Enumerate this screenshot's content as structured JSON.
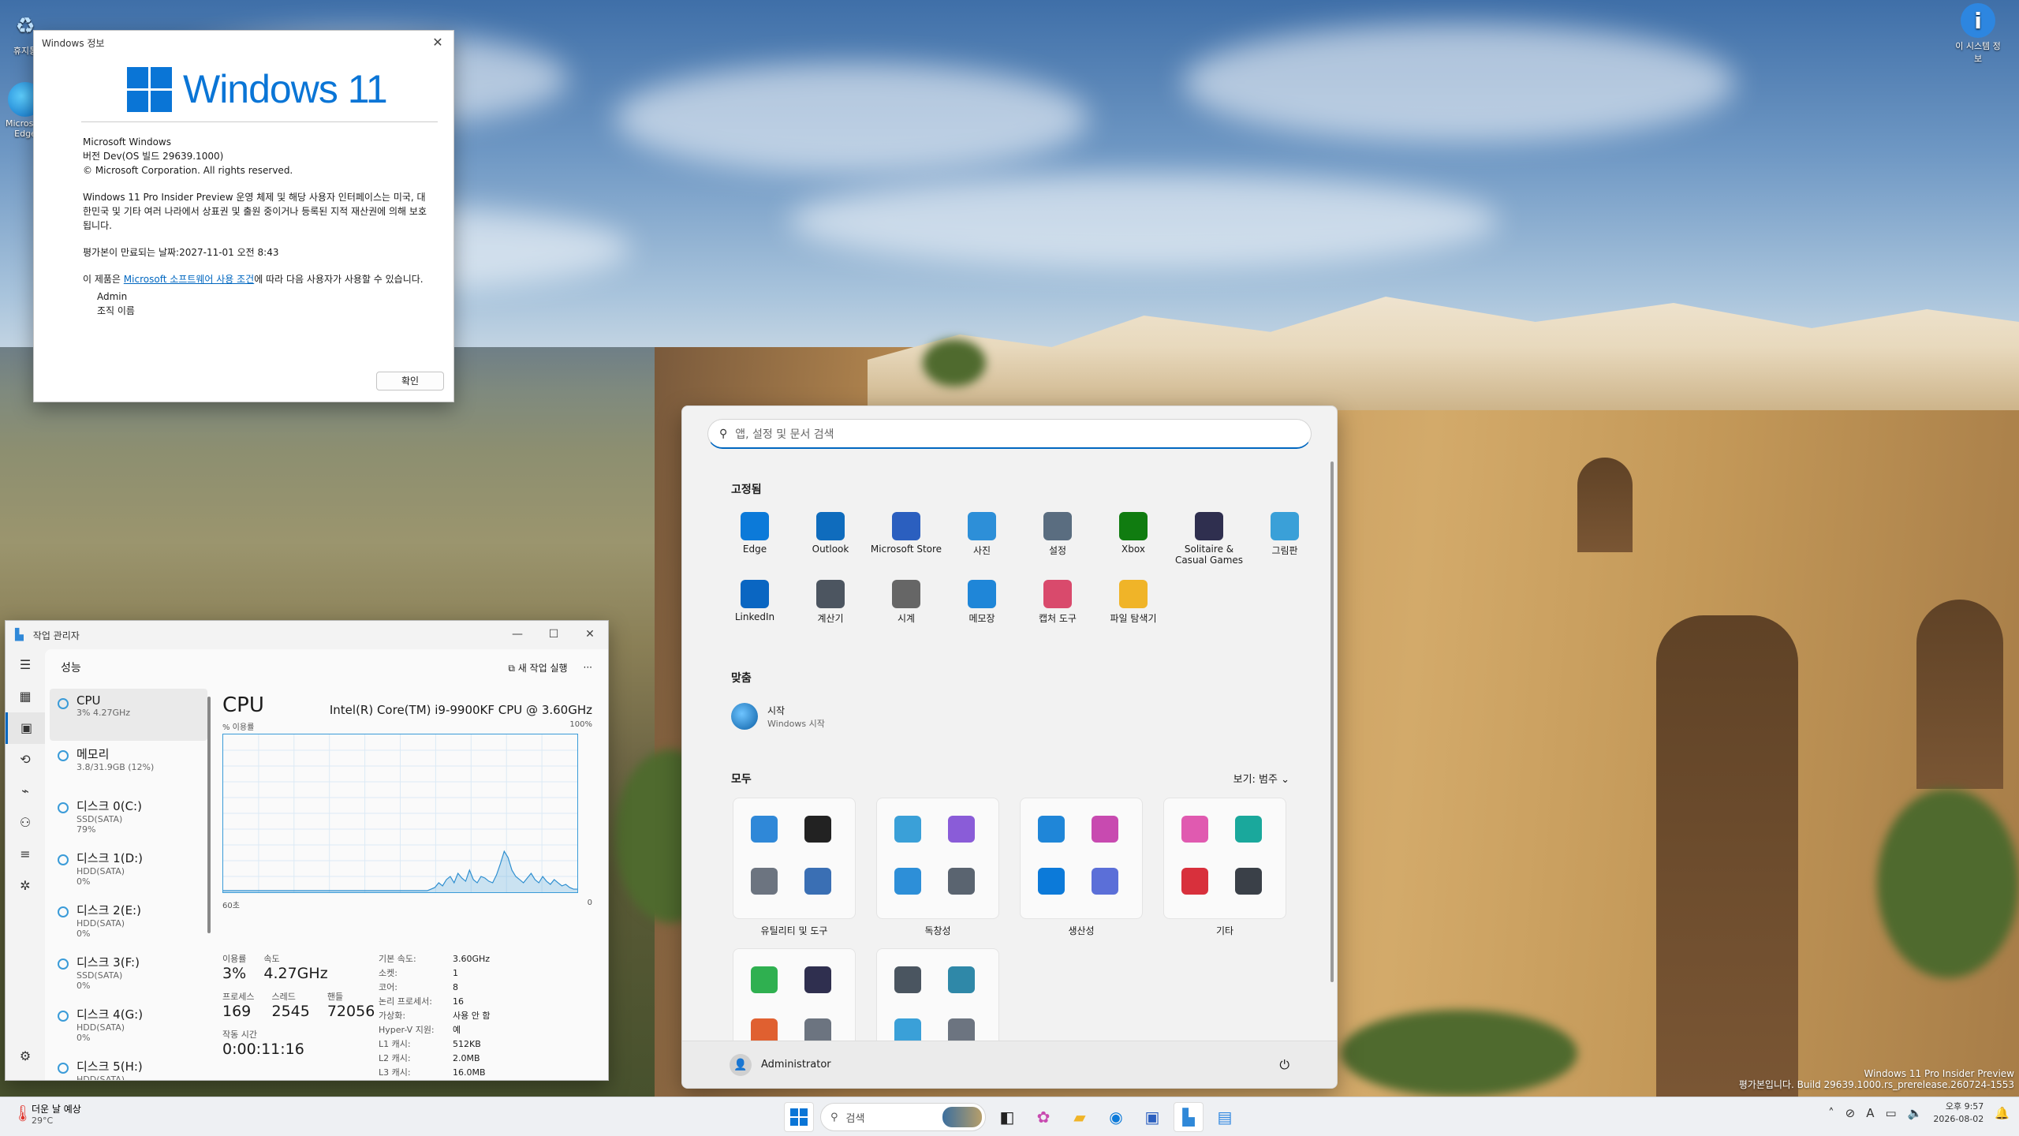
{
  "desktop": {
    "icons_left": [
      {
        "label": "휴지통",
        "icon": "recycle-bin-icon"
      },
      {
        "label": "Microsoft Edge",
        "icon": "edge-icon"
      }
    ],
    "icon_right": {
      "label": "이 시스템 정보",
      "icon": "info-icon"
    }
  },
  "about_dialog": {
    "title": "Windows 정보",
    "logo_text": "Windows 11",
    "product": "Microsoft Windows",
    "version": "버전 Dev(OS 빌드 29639.1000)",
    "copyright": "© Microsoft Corporation. All rights reserved.",
    "description": "Windows 11 Pro Insider Preview 운영 체제 및 해당 사용자 인터페이스는 미국, 대한민국 및 기타 여러 나라에서 상표권 및 출원 중이거나 등록된 지적 재산권에 의해 보호됩니다.",
    "expiry": "평가본이 만료되는 날짜:2027-11-01 오전 8:43",
    "license_prefix": "이 제품은 ",
    "license_link": "Microsoft 소프트웨어 사용 조건",
    "license_suffix": "에 따라 다음 사용자가 사용할 수 있습니다.",
    "user": "Admin",
    "org": "조직 이름",
    "ok_label": "확인"
  },
  "task_manager": {
    "title": "작업 관리자",
    "section": "성능",
    "run_new_task": "새 작업 실행",
    "more": "···",
    "items": [
      {
        "name": "CPU",
        "sub1": "3% 4.27GHz",
        "sub2": ""
      },
      {
        "name": "메모리",
        "sub1": "3.8/31.9GB (12%)",
        "sub2": ""
      },
      {
        "name": "디스크 0(C:)",
        "sub1": "SSD(SATA)",
        "sub2": "79%"
      },
      {
        "name": "디스크 1(D:)",
        "sub1": "HDD(SATA)",
        "sub2": "0%"
      },
      {
        "name": "디스크 2(E:)",
        "sub1": "HDD(SATA)",
        "sub2": "0%"
      },
      {
        "name": "디스크 3(F:)",
        "sub1": "SSD(SATA)",
        "sub2": "0%"
      },
      {
        "name": "디스크 4(G:)",
        "sub1": "HDD(SATA)",
        "sub2": "0%"
      },
      {
        "name": "디스크 5(H:)",
        "sub1": "HDD(SATA)",
        "sub2": ""
      }
    ],
    "cpu": {
      "title": "CPU",
      "model": "Intel(R) Core(TM) i9-9900KF CPU @ 3.60GHz",
      "usage_label": "% 이용률",
      "max_label": "100%",
      "time_label": "60초",
      "min_label": "0",
      "history": [
        1,
        1,
        1,
        1,
        1,
        1,
        1,
        1,
        1,
        1,
        1,
        1,
        1,
        1,
        1,
        1,
        1,
        1,
        1,
        1,
        1,
        1,
        1,
        1,
        1,
        1,
        1,
        1,
        1,
        1,
        1,
        1,
        1,
        1,
        1,
        1,
        1,
        1,
        1,
        1,
        1,
        1,
        1,
        1,
        1,
        1,
        1,
        1,
        1,
        1,
        1,
        1,
        1,
        1,
        2,
        3,
        6,
        4,
        8,
        10,
        6,
        12,
        9,
        7,
        14,
        8,
        6,
        10,
        9,
        7,
        6,
        11,
        18,
        26,
        22,
        14,
        10,
        8,
        6,
        9,
        12,
        8,
        6,
        10,
        7,
        5,
        8,
        6,
        4,
        5,
        3,
        2,
        2
      ],
      "utilization_label": "이용률",
      "utilization": "3%",
      "speed_label": "속도",
      "speed": "4.27GHz",
      "processes_label": "프로세스",
      "processes": "169",
      "threads_label": "스레드",
      "threads": "2545",
      "handles_label": "핸들",
      "handles": "72056",
      "uptime_label": "작동 시간",
      "uptime": "0:00:11:16",
      "specs": [
        {
          "k": "기본 속도:",
          "v": "3.60GHz"
        },
        {
          "k": "소켓:",
          "v": "1"
        },
        {
          "k": "코어:",
          "v": "8"
        },
        {
          "k": "논리 프로세서:",
          "v": "16"
        },
        {
          "k": "가상화:",
          "v": "사용 안 함"
        },
        {
          "k": "Hyper-V 지원:",
          "v": "예"
        },
        {
          "k": "L1 캐시:",
          "v": "512KB"
        },
        {
          "k": "L2 캐시:",
          "v": "2.0MB"
        },
        {
          "k": "L3 캐시:",
          "v": "16.0MB"
        }
      ]
    }
  },
  "start_menu": {
    "search_placeholder": "앱, 설정 및 문서 검색",
    "pinned_title": "고정됨",
    "pinned": [
      {
        "label": "Edge",
        "icon": "edge-icon",
        "color": "#0c7ad9"
      },
      {
        "label": "Outlook",
        "icon": "outlook-icon",
        "color": "#0f6cbd"
      },
      {
        "label": "Microsoft Store",
        "icon": "store-icon",
        "color": "#2b5fbf"
      },
      {
        "label": "사진",
        "icon": "photos-icon",
        "color": "#2d8fd8"
      },
      {
        "label": "설정",
        "icon": "gear-icon",
        "color": "#5a6d80"
      },
      {
        "label": "Xbox",
        "icon": "xbox-icon",
        "color": "#107c10"
      },
      {
        "label": "Solitaire & Casual Games",
        "icon": "solitaire-icon",
        "color": "#2f2f4f"
      },
      {
        "label": "그림판",
        "icon": "paint-icon",
        "color": "#3aa0d8"
      },
      {
        "label": "LinkedIn",
        "icon": "linkedin-icon",
        "color": "#0a66c2"
      },
      {
        "label": "계산기",
        "icon": "calculator-icon",
        "color": "#4c5560"
      },
      {
        "label": "시계",
        "icon": "clock-icon",
        "color": "#666666"
      },
      {
        "label": "메모장",
        "icon": "notepad-icon",
        "color": "#1f86d8"
      },
      {
        "label": "캡처 도구",
        "icon": "snipping-tool-icon",
        "color": "#d94a6c"
      },
      {
        "label": "파일 탐색기",
        "icon": "folder-icon",
        "color": "#f0b428"
      }
    ],
    "recommended_title": "맞춤",
    "recommended": {
      "title": "시작",
      "subtitle": "Windows 시작"
    },
    "all_title": "모두",
    "view_label": "보기: 범주 ⌄",
    "categories": [
      {
        "label": "유틸리티 및 도구",
        "colors": [
          "#2f88d8",
          "#222222",
          "#6c7480",
          "#3a6fb4"
        ]
      },
      {
        "label": "독창성",
        "colors": [
          "#3aa0d8",
          "#8a5cd8",
          "#2d8fd8",
          "#5a6470"
        ]
      },
      {
        "label": "생산성",
        "colors": [
          "#1f86d8",
          "#c84ab0",
          "#0c7ad9",
          "#5b6fd8"
        ]
      },
      {
        "label": "기타",
        "colors": [
          "#e05ab0",
          "#1aa89c",
          "#d8303c",
          "#3a4048"
        ]
      },
      {
        "label": "",
        "colors": [
          "#2fb050",
          "#2f2f4f",
          "#e06030",
          "#6c7480"
        ]
      },
      {
        "label": "",
        "colors": [
          "#4a5560",
          "#2f88a8",
          "#3aa0d8",
          "#6c7480"
        ]
      }
    ],
    "user": "Administrator"
  },
  "watermark": {
    "line1": "Windows 11 Pro Insider Preview",
    "line2": "평가본입니다. Build 29639.1000.rs_prerelease.260724-1553"
  },
  "taskbar": {
    "weather_title": "더운 날 예상",
    "weather_temp": "29°C",
    "search_label": "검색",
    "time": "오후 9:57",
    "date": "2026-08-02"
  }
}
